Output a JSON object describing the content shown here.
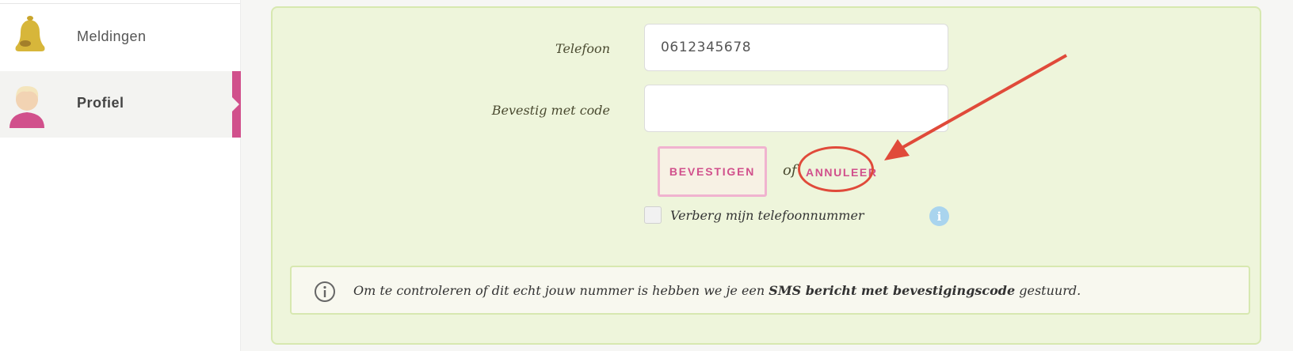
{
  "sidebar": {
    "items": [
      {
        "label": "Meldingen",
        "icon": "bell-icon",
        "active": false
      },
      {
        "label": "Profiel",
        "icon": "avatar-icon",
        "active": true
      }
    ],
    "accent_color": "#d1508c"
  },
  "form": {
    "phone": {
      "label": "Telefoon",
      "value": "0612345678"
    },
    "code": {
      "label": "Bevestig met code",
      "value": ""
    },
    "confirm_button": "BEVESTIGEN",
    "or_text": "of",
    "cancel_link": "ANNULEER",
    "hide_phone": {
      "label": "Verberg mijn telefoonnummer",
      "checked": false
    },
    "info_glyph": "i"
  },
  "notice": {
    "text_before": "Om te controleren of dit echt jouw nummer is hebben we je een ",
    "text_bold": "SMS bericht met bevestigingscode",
    "text_after": " gestuurd."
  },
  "annotation": {
    "color": "#e04a3a"
  }
}
